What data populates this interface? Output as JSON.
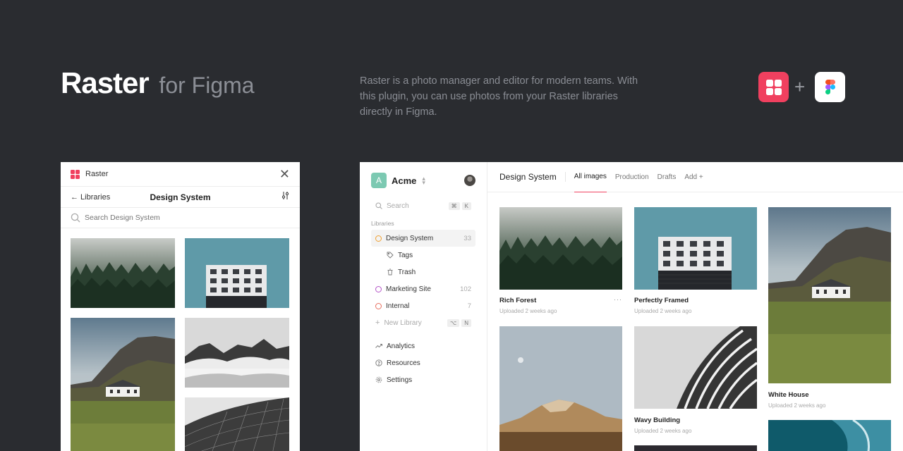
{
  "hero": {
    "title": "Raster",
    "subtitle": "for Figma",
    "description": "Raster is a photo manager and editor for modern teams. With this plugin, you can use photos from your Raster libraries directly in Figma.",
    "plus": "+"
  },
  "plugin": {
    "app_name": "Raster",
    "close": "✕",
    "back_label": "← Libraries",
    "title": "Design System",
    "search_placeholder": "Search Design System"
  },
  "app": {
    "workspace": {
      "initial": "A",
      "name": "Acme"
    },
    "search": {
      "label": "Search",
      "keys": [
        "⌘",
        "K"
      ]
    },
    "libraries_heading": "Libraries",
    "libraries": [
      {
        "label": "Design System",
        "count": "33",
        "color": "#f0a030"
      },
      {
        "label": "Marketing Site",
        "count": "102",
        "color": "#b455c8"
      },
      {
        "label": "Internal",
        "count": "7",
        "color": "#e87060"
      }
    ],
    "sub_items": [
      {
        "label": "Tags"
      },
      {
        "label": "Trash"
      }
    ],
    "new_library": {
      "label": "New Library",
      "keys": [
        "⌥",
        "N"
      ]
    },
    "footer_items": [
      {
        "label": "Analytics"
      },
      {
        "label": "Resources"
      },
      {
        "label": "Settings"
      }
    ],
    "main_title": "Design System",
    "tabs": [
      "All images",
      "Production",
      "Drafts",
      "Add +"
    ],
    "cards": [
      {
        "title": "Rich Forest",
        "meta": "Uploaded 2 weeks ago",
        "more": "···"
      },
      {
        "title": "Perfectly Framed",
        "meta": "Uploaded 2 weeks ago"
      },
      {
        "title": "White House",
        "meta": "Uploaded 2 weeks ago"
      },
      {
        "title": "Wavy Building",
        "meta": "Uploaded 2 weeks ago"
      }
    ]
  },
  "colors": {
    "accent": "#f0405f",
    "background": "#2a2c30",
    "workspace_badge": "#7cc9b2"
  }
}
